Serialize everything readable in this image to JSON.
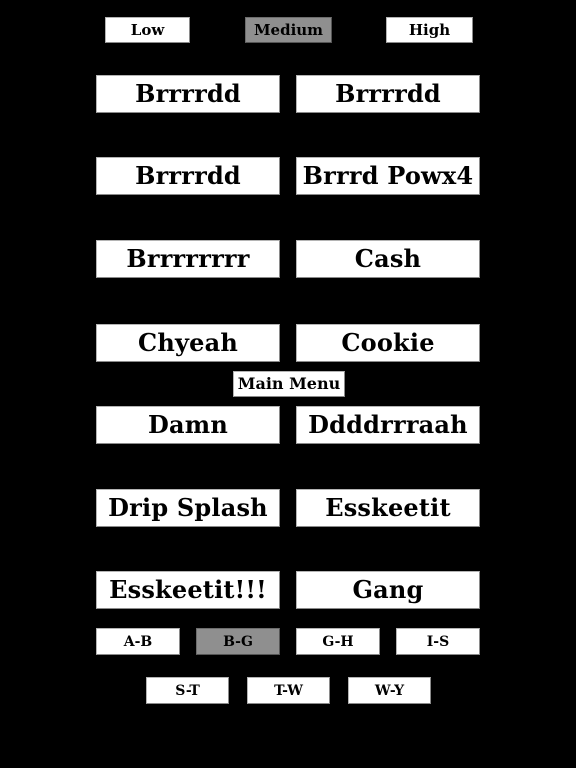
{
  "app": {
    "background_color": "#000000",
    "button_color": "#ffffff",
    "selected_button_color": "#8f8f8f",
    "text_color": "#000000"
  },
  "difficulty": {
    "options": [
      {
        "label": "Low",
        "selected": false
      },
      {
        "label": "Medium",
        "selected": true
      },
      {
        "label": "High",
        "selected": false
      }
    ]
  },
  "main_menu": {
    "label": "Main Menu"
  },
  "sounds": {
    "rows": [
      {
        "left": "Brrrrdd",
        "right": "Brrrrdd"
      },
      {
        "left": "Brrrrdd",
        "right": "Brrrd Powx4"
      },
      {
        "left": "Brrrrrrrr",
        "right": "Cash"
      },
      {
        "left": "Chyeah",
        "right": "Cookie"
      },
      {
        "left": "Damn",
        "right": "Ddddrrraah"
      },
      {
        "left": "Drip Splash",
        "right": "Esskeetit"
      },
      {
        "left": "Esskeetit!!!",
        "right": "Gang"
      }
    ]
  },
  "alphabet_nav": {
    "row_a": [
      {
        "label": "A-B",
        "selected": false
      },
      {
        "label": "B-G",
        "selected": true
      },
      {
        "label": "G-H",
        "selected": false
      },
      {
        "label": "I-S",
        "selected": false
      }
    ],
    "row_b": [
      {
        "label": "S-T",
        "selected": false
      },
      {
        "label": "T-W",
        "selected": false
      },
      {
        "label": "W-Y",
        "selected": false
      }
    ]
  }
}
